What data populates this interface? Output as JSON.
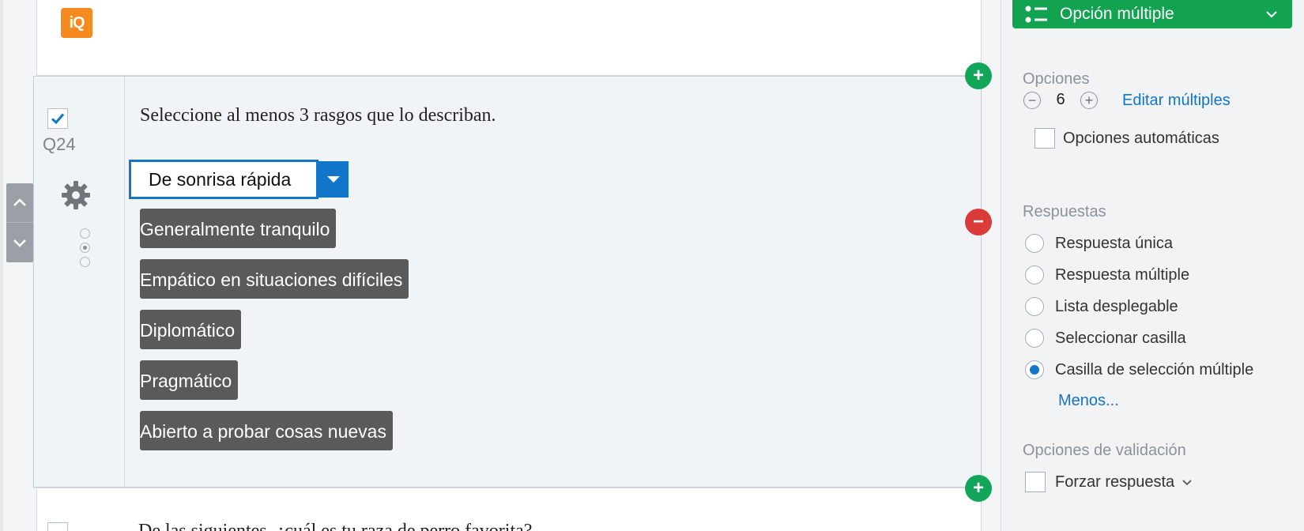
{
  "logo": {
    "text": "iQ",
    "color": "#f68a1e"
  },
  "question": {
    "number": "Q24",
    "text": "Seleccione al menos 3 rasgos que lo describan.",
    "selected": true,
    "dropdown_choice": "De sonrisa rápida",
    "choices": [
      "Generalmente tranquilo",
      "Empático en situaciones difíciles",
      "Diplomático",
      "Pragmático",
      "Abierto a probar cosas nuevas"
    ]
  },
  "next_question": {
    "text": "De las siguientes, ¿cuál es tu raza de perro favorita?"
  },
  "panel": {
    "question_type": "Opción múltiple",
    "options_label": "Opciones",
    "options_count": "6",
    "edit_multiple": "Editar múltiples",
    "auto_choices": "Opciones automáticas",
    "answers_label": "Respuestas",
    "answers": [
      {
        "label": "Respuesta única",
        "selected": false
      },
      {
        "label": "Respuesta múltiple",
        "selected": false
      },
      {
        "label": "Lista desplegable",
        "selected": false
      },
      {
        "label": "Seleccionar casilla",
        "selected": false
      },
      {
        "label": "Casilla de selección múltiple",
        "selected": true
      }
    ],
    "less_link": "Menos...",
    "validation_label": "Opciones de validación",
    "force_response": "Forzar respuesta"
  },
  "colors": {
    "accent": "#1175c9",
    "green": "#13a24f",
    "red": "#d93b3b",
    "choice_bg": "#5a5a5a"
  },
  "icons": [
    "check-icon",
    "gear-icon",
    "chevron-up-icon",
    "chevron-down-icon",
    "plus-icon",
    "minus-icon",
    "list-icon"
  ]
}
